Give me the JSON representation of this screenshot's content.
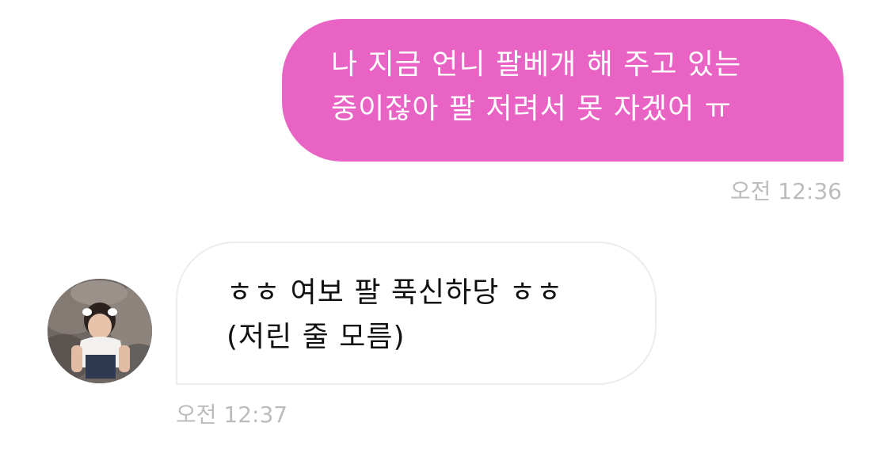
{
  "conversation": {
    "outgoing": {
      "line1": "나 지금 언니 팔베개 해 주고 있는",
      "line2": "중이잖아 팔 저려서 못 자겠어 ㅠ",
      "time": "오전 12:36",
      "bubble_color": "#E963C4"
    },
    "incoming": {
      "line1": "ㅎㅎ 여보 팔 푹신하당 ㅎㅎ",
      "line2": "(저린 줄 모름)",
      "time": "오전 12:37",
      "avatar_icon": "child-profile-photo"
    }
  }
}
